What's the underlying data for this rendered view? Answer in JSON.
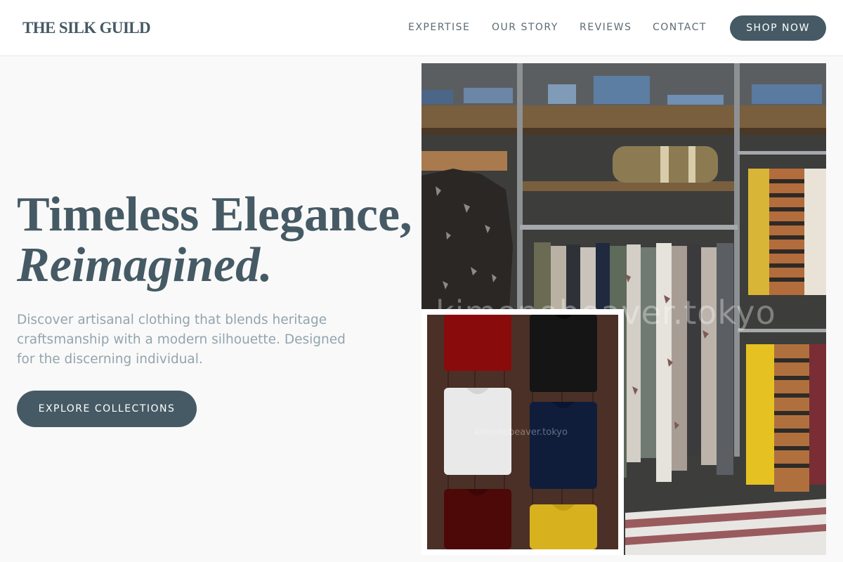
{
  "header": {
    "brand": "THE SILK GUILD",
    "nav": [
      "EXPERTISE",
      "OUR STORY",
      "REVIEWS",
      "CONTACT"
    ],
    "cta_label": "SHOP NOW"
  },
  "hero": {
    "headline_line1": "Timeless Elegance,",
    "headline_line2": "Reimagined.",
    "subtext": "Discover artisanal clothing that blends heritage craftsmanship with a modern silhouette. Designed for the discerning individual.",
    "button_label": "EXPLORE COLLECTIONS"
  },
  "images": {
    "main_watermark": "kimonobeaver.tokyo",
    "inset_watermark": "kimonobeaver.tokyo"
  },
  "colors": {
    "primary": "#455a64",
    "background": "#f9f9f9",
    "muted_text": "#93a4ad"
  }
}
